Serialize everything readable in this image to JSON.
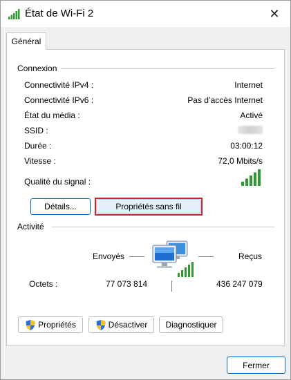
{
  "window": {
    "title": "État de Wi-Fi 2",
    "close_glyph": "✕"
  },
  "tabs": [
    {
      "label": "Général"
    }
  ],
  "connexion": {
    "title": "Connexion",
    "rows": [
      {
        "label": "Connectivité IPv4 :",
        "value": "Internet"
      },
      {
        "label": "Connectivité IPv6 :",
        "value": "Pas d’accès Internet"
      },
      {
        "label": "État du média :",
        "value": "Activé"
      },
      {
        "label": "SSID :",
        "value": ""
      },
      {
        "label": "Durée :",
        "value": "03:00:12"
      },
      {
        "label": "Vitesse :",
        "value": "72,0 Mbits/s"
      }
    ],
    "signal_label": "Qualité du signal :",
    "signal_bars": 5,
    "details_button": "Détails...",
    "wireless_props_button": "Propriétés sans fil"
  },
  "activite": {
    "title": "Activité",
    "sent_label": "Envoyés",
    "received_label": "Reçus",
    "bytes_label": "Octets :",
    "bytes_sent": "77 073 814",
    "bytes_received": "436 247 079"
  },
  "actions": {
    "properties_button": "Propriétés",
    "disable_button": "Désactiver",
    "diagnose_button": "Diagnostiquer"
  },
  "footer": {
    "close_button": "Fermer"
  },
  "colors": {
    "signal_green": "#2f9a2f",
    "accent_blue": "#0067c0",
    "highlight_red": "#d0202a"
  },
  "icons": [
    "wifi-signal-icon",
    "close-icon",
    "network-computers-icon",
    "uac-shield-icon"
  ]
}
